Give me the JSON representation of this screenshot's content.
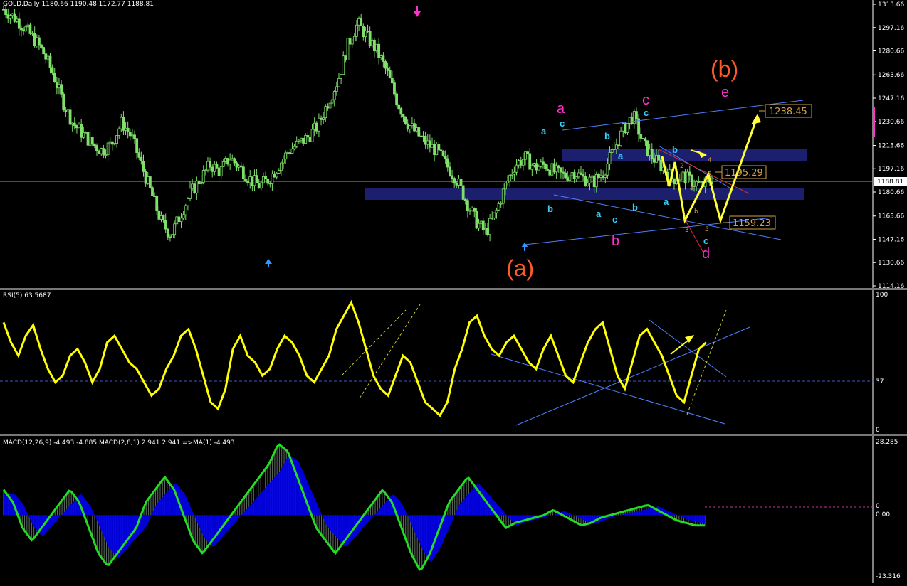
{
  "header": {
    "main_title": "GOLD,Daily  1180.66 1190.48 1172.77 1188.81",
    "rsi_title": "RSI(5) 63.5687",
    "macd_title": "MACD(12,26,9) -4.493 -4.885  MACD(2,8,1) 2.941 2.941  =>MA(1) -4.493"
  },
  "colors": {
    "background": "#000000",
    "candles": "#7fe06a",
    "trendlines": "#4f7fff",
    "zones": "#1c1f6e",
    "rsi_line": "#ffff00",
    "macd_line": "#22dd22",
    "macd_fill": "#0000ee",
    "wave_cyan": "#36d0ff",
    "wave_magenta": "#ff33cc",
    "wave_orange": "#ff5a2a",
    "arrows": "#ffff33",
    "price_tag": "#cfa14a"
  },
  "chart_data": [
    {
      "type": "candlestick",
      "name": "GOLD Daily",
      "y_axis_ticks": [
        "1313.66",
        "1297.16",
        "1280.66",
        "1263.66",
        "1247.16",
        "1230.66",
        "1213.66",
        "1197.16",
        "1180.66",
        "1163.66",
        "1147.16",
        "1130.66",
        "1114.16"
      ],
      "ylim": [
        1114.16,
        1313.66
      ],
      "current_price": "1188.81",
      "price_path": [
        1310,
        1305,
        1298,
        1290,
        1280,
        1265,
        1245,
        1230,
        1222,
        1215,
        1210,
        1215,
        1230,
        1220,
        1200,
        1180,
        1160,
        1150,
        1165,
        1180,
        1190,
        1200,
        1195,
        1205,
        1198,
        1190,
        1185,
        1190,
        1200,
        1210,
        1215,
        1220,
        1228,
        1245,
        1260,
        1285,
        1300,
        1290,
        1280,
        1265,
        1245,
        1230,
        1222,
        1215,
        1210,
        1200,
        1190,
        1175,
        1160,
        1152,
        1165,
        1185,
        1200,
        1205,
        1198,
        1200,
        1195,
        1192,
        1195,
        1190,
        1188,
        1195,
        1210,
        1225,
        1235,
        1215,
        1205,
        1198,
        1190,
        1192,
        1188,
        1185,
        1190
      ],
      "price_labels": [
        "1238.45",
        "1195.29",
        "1159.23"
      ],
      "wave_labels": {
        "a_big": "(a)",
        "b_big": "(b)",
        "a_cyan_1": "a",
        "c_cyan_1": "c",
        "b_cyan_1": "b",
        "b_cyan_2": "b",
        "a_cyan_2": "a",
        "a_cyan_3": "a",
        "c_cyan_2": "c",
        "b_cyan_3": "b",
        "c_cyan_3": "c",
        "a_cyan_4": "a",
        "b_cyan_4": "b",
        "c_cyan_4": "c",
        "a_mag": "a",
        "b_mag": "b",
        "c_mag": "c",
        "d_mag": "d",
        "e_mag": "e",
        "n1": "1",
        "n2": "2",
        "n3": "3",
        "n4": "4",
        "n5": "5",
        "sm_a": "a",
        "sm_b": "b",
        "sm_c": "c"
      }
    },
    {
      "type": "line",
      "name": "RSI(5)",
      "y_axis_ticks": [
        "100",
        "37",
        "0"
      ],
      "ylim": [
        0,
        100
      ],
      "level": 37,
      "values": [
        80,
        65,
        55,
        70,
        78,
        60,
        45,
        35,
        40,
        55,
        60,
        50,
        35,
        45,
        65,
        70,
        60,
        50,
        45,
        35,
        25,
        30,
        45,
        55,
        70,
        75,
        60,
        40,
        20,
        15,
        30,
        60,
        70,
        55,
        50,
        40,
        45,
        60,
        70,
        65,
        55,
        40,
        35,
        45,
        55,
        75,
        85,
        95,
        80,
        60,
        40,
        30,
        25,
        40,
        55,
        50,
        35,
        20,
        15,
        10,
        20,
        45,
        60,
        80,
        85,
        70,
        60,
        55,
        65,
        70,
        60,
        50,
        45,
        60,
        70,
        55,
        40,
        35,
        50,
        65,
        75,
        80,
        60,
        40,
        30,
        50,
        70,
        75,
        65,
        55,
        40,
        25,
        20,
        40,
        60,
        65
      ]
    },
    {
      "type": "area",
      "name": "MACD",
      "y_axis_ticks": [
        "28.285",
        "0",
        "0.00",
        "-23.316"
      ],
      "ylim": [
        -23.316,
        28.285
      ],
      "values": [
        10,
        5,
        -5,
        -10,
        -5,
        0,
        5,
        10,
        5,
        -5,
        -15,
        -20,
        -15,
        -10,
        -5,
        5,
        10,
        15,
        10,
        0,
        -10,
        -15,
        -10,
        -5,
        0,
        5,
        10,
        15,
        20,
        28,
        25,
        15,
        5,
        -5,
        -10,
        -15,
        -10,
        -5,
        0,
        5,
        10,
        5,
        -5,
        -15,
        -22,
        -15,
        -5,
        5,
        10,
        15,
        10,
        5,
        0,
        -5,
        -3,
        -2,
        -1,
        0,
        2,
        0,
        -2,
        -4,
        -3,
        -1,
        0,
        1,
        2,
        3,
        4,
        2,
        0,
        -2,
        -3,
        -4,
        -4
      ]
    }
  ]
}
